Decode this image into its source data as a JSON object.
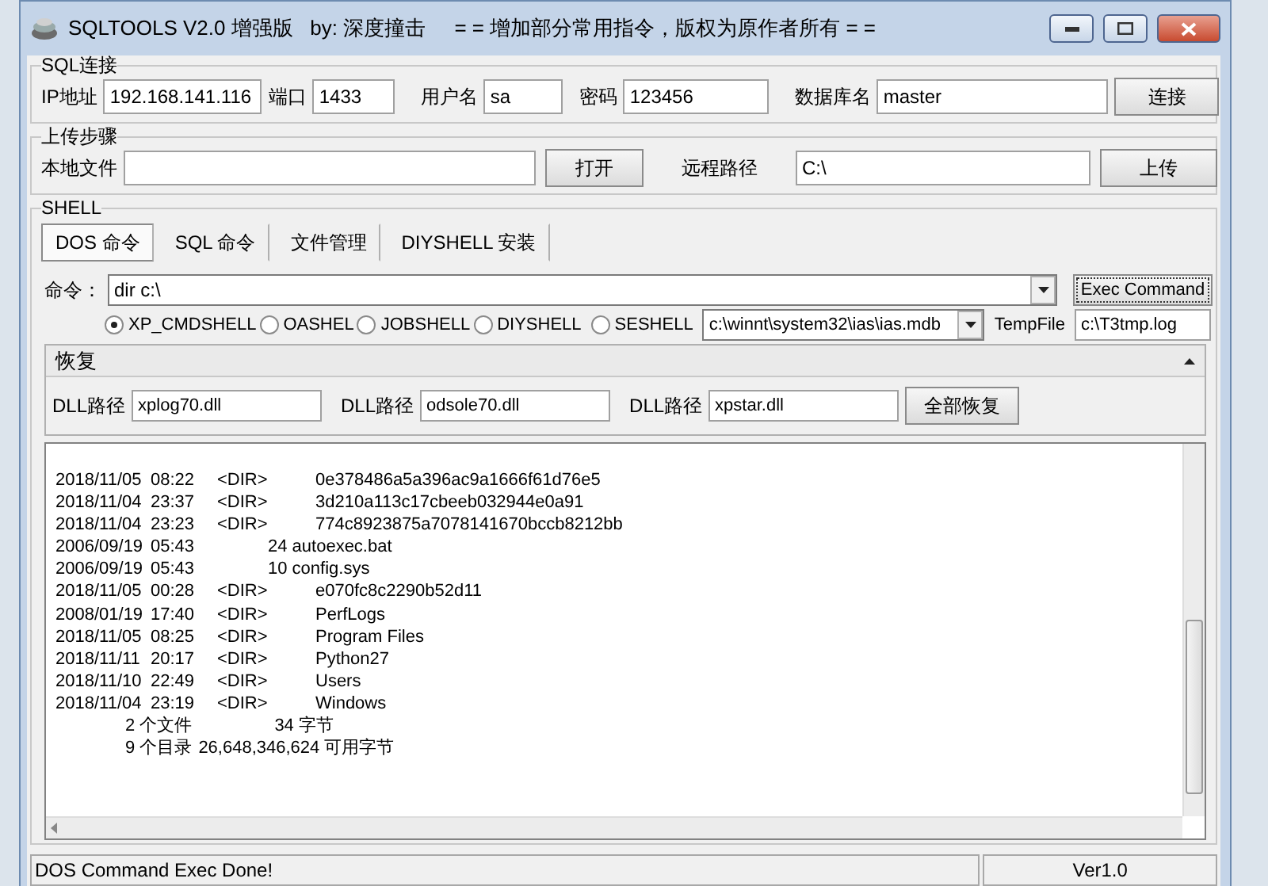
{
  "window": {
    "title": "SQLTOOLS V2.0 增强版   by: 深度撞击     = = 增加部分常用指令，版权为原作者所有 = ="
  },
  "sql_connection": {
    "legend": "SQL连接",
    "fields": [
      {
        "label": "IP地址",
        "value": "192.168.141.116"
      },
      {
        "label": "端口",
        "value": "1433"
      },
      {
        "label": "用户名",
        "value": "sa"
      },
      {
        "label": "密码",
        "value": "123456"
      },
      {
        "label": "数据库名",
        "value": "master"
      }
    ],
    "button": "连接"
  },
  "upload": {
    "legend": "上传步骤",
    "local_label": "本地文件",
    "open_button": "打开",
    "remote_label": "远程路径",
    "remote_value": "C:\\",
    "upload_button": "上传"
  },
  "shell": {
    "legend": "SHELL",
    "tabs": [
      {
        "label": "DOS 命令",
        "selected": true
      },
      {
        "label": "SQL 命令",
        "selected": false
      },
      {
        "label": "文件管理",
        "selected": false
      },
      {
        "label": "DIYSHELL 安装",
        "selected": false
      }
    ],
    "command_label": "命令：",
    "command_value": "dir c:\\",
    "exec_button": "Exec Command",
    "shell_options": [
      {
        "label": "XP_CMDSHELL",
        "selected": true
      },
      {
        "label": "OASHEL",
        "selected": false
      },
      {
        "label": "JOBSHELL",
        "selected": false
      },
      {
        "label": "DIYSHELL",
        "selected": false
      },
      {
        "label": "SESHELL",
        "selected": false
      }
    ],
    "mdb_path": "c:\\winnt\\system32\\ias\\ias.mdb",
    "tempfile_label": "TempFile",
    "tempfile_value": "c:\\T3tmp.log",
    "restore": {
      "title": "恢复",
      "expanded": true,
      "dlls": [
        {
          "label": "DLL路径",
          "value": "xplog70.dll"
        },
        {
          "label": "DLL路径",
          "value": "odsole70.dll"
        },
        {
          "label": "DLL路径",
          "value": "xpstar.dll"
        }
      ],
      "button": "全部恢复"
    },
    "output": [
      {
        "kind": "entry",
        "date": "2018/11/05",
        "time": "08:22",
        "dir": "<DIR>",
        "name": "0e378486a5a396ac9a1666f61d76e5"
      },
      {
        "kind": "entry",
        "date": "2018/11/04",
        "time": "23:37",
        "dir": "<DIR>",
        "name": "3d210a113c17cbeeb032944e0a91"
      },
      {
        "kind": "entry",
        "date": "2018/11/04",
        "time": "23:23",
        "dir": "<DIR>",
        "name": "774c8923875a7078141670bccb8212bb"
      },
      {
        "kind": "entry",
        "date": "2006/09/19",
        "time": "05:43",
        "size": "24",
        "name": "autoexec.bat"
      },
      {
        "kind": "entry",
        "date": "2006/09/19",
        "time": "05:43",
        "size": "10",
        "name": "config.sys"
      },
      {
        "kind": "entry",
        "date": "2018/11/05",
        "time": "00:28",
        "dir": "<DIR>",
        "name": "e070fc8c2290b52d11"
      },
      {
        "kind": "entry",
        "date": "2008/01/19",
        "time": "17:40",
        "dir": "<DIR>",
        "name": "PerfLogs"
      },
      {
        "kind": "entry",
        "date": "2018/11/05",
        "time": "08:25",
        "dir": "<DIR>",
        "name": "Program Files"
      },
      {
        "kind": "entry",
        "date": "2018/11/11",
        "time": "20:17",
        "dir": "<DIR>",
        "name": "Python27"
      },
      {
        "kind": "entry",
        "date": "2018/11/10",
        "time": "22:49",
        "dir": "<DIR>",
        "name": "Users"
      },
      {
        "kind": "entry",
        "date": "2018/11/04",
        "time": "23:19",
        "dir": "<DIR>",
        "name": "Windows"
      },
      {
        "kind": "summary",
        "count": "2 个文件",
        "amount": "34 字节"
      },
      {
        "kind": "summary",
        "count": "9 个目录",
        "amount": "26,648,346,624 可用字节"
      }
    ]
  },
  "status_bar": {
    "message": "DOS Command Exec Done!",
    "version": "Ver1.0"
  }
}
